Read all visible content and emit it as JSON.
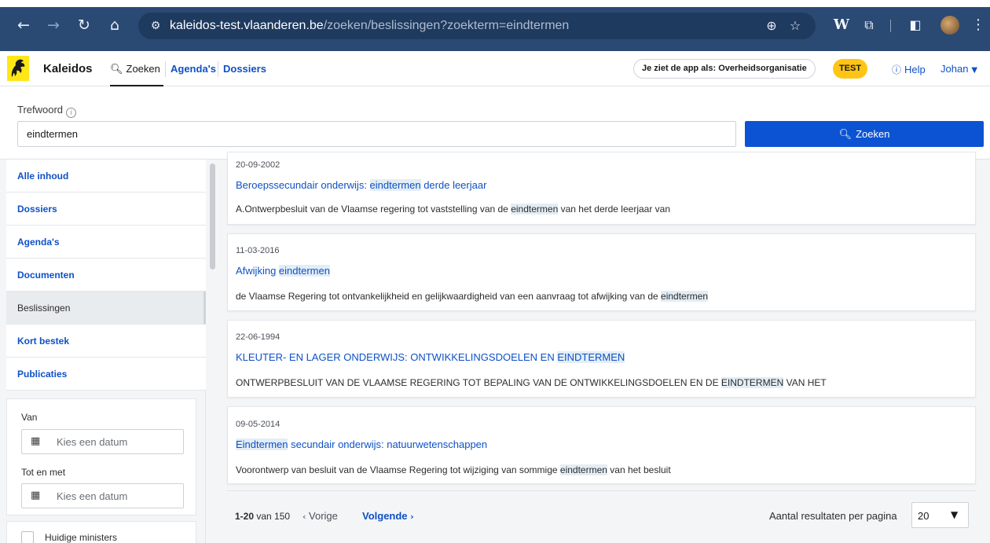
{
  "browser": {
    "url_host": "kaleidos-test.vlaanderen.be",
    "url_path": "/zoeken/beslissingen?zoekterm=eindtermen"
  },
  "app": {
    "brand": "Kaleidos",
    "nav": {
      "search": "Zoeken",
      "agendas": "Agenda's",
      "dossiers": "Dossiers"
    },
    "role_text": "Je ziet de app als: Overheidsorganisatie",
    "env_badge": "TEST",
    "help": "Help",
    "user": "Johan"
  },
  "search": {
    "label": "Trefwoord",
    "value": "eindtermen",
    "button": "Zoeken"
  },
  "sidebar": {
    "items": [
      {
        "label": "Alle inhoud"
      },
      {
        "label": "Dossiers"
      },
      {
        "label": "Agenda's"
      },
      {
        "label": "Documenten"
      },
      {
        "label": "Beslissingen"
      },
      {
        "label": "Kort bestek"
      },
      {
        "label": "Publicaties"
      }
    ],
    "active": "Beslissingen",
    "van_label": "Van",
    "van_placeholder": "Kies een datum",
    "tot_label": "Tot en met",
    "tot_placeholder": "Kies een datum",
    "ministers_label": "Huidige ministers"
  },
  "results": [
    {
      "date": "20-09-2002",
      "title": [
        "Beroepssecundair onderwijs: ",
        "eindtermen",
        " derde leerjaar"
      ],
      "snippet": [
        "A.Ontwerpbesluit van de Vlaamse regering tot vaststelling van de ",
        "eindtermen",
        " van het derde leerjaar van"
      ]
    },
    {
      "date": "11-03-2016",
      "title": [
        "Afwijking ",
        "eindtermen",
        ""
      ],
      "snippet": [
        "de Vlaamse Regering tot ontvankelijkheid en gelijkwaardigheid van een aanvraag tot afwijking van de ",
        "eindtermen",
        ""
      ]
    },
    {
      "date": "22-06-1994",
      "title": [
        "KLEUTER- EN LAGER ONDERWIJS: ONTWIKKELINGSDOELEN EN ",
        "EINDTERMEN",
        ""
      ],
      "snippet": [
        "ONTWERPBESLUIT VAN DE VLAAMSE REGERING TOT BEPALING VAN DE ONTWIKKELINGSDOELEN EN DE ",
        "EINDTERMEN",
        " VAN HET"
      ]
    },
    {
      "date": "09-05-2014",
      "title": [
        "",
        "Eindtermen",
        " secundair onderwijs: natuurwetenschappen"
      ],
      "snippet": [
        "Voorontwerp van besluit van de Vlaamse Regering tot wijziging van sommige ",
        "eindtermen",
        " van het besluit"
      ]
    }
  ],
  "pager": {
    "range": "1-20",
    "of": "van 150",
    "prev": "Vorige",
    "next": "Volgende",
    "per_page_label": "Aantal resultaten per pagina",
    "per_page": "20"
  },
  "colors": {
    "link": "#0e51c6",
    "primary_button": "#0c53d3",
    "test_badge": "#ffc515",
    "highlight": "#e3edf5"
  },
  "icons": [
    "back-icon",
    "forward-icon",
    "reload-icon",
    "home-icon",
    "site-settings-icon",
    "zoom-icon",
    "bookmark-star-icon",
    "wikipedia-extension-icon",
    "extensions-puzzle-icon",
    "side-panel-icon",
    "profile-avatar",
    "browser-menu-icon",
    "flanders-lion-logo",
    "search-icon",
    "info-icon",
    "help-icon",
    "chevron-down-icon",
    "calendar-icon",
    "chevron-left-icon",
    "chevron-right-icon"
  ]
}
